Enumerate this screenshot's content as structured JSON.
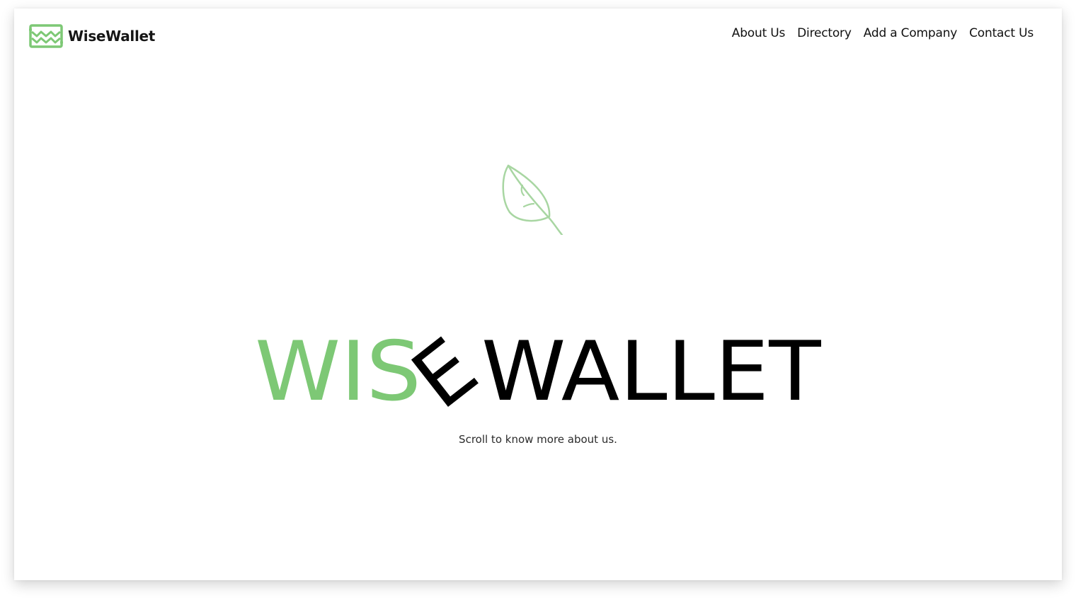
{
  "brand": {
    "name": "WiseWallet",
    "logo_icon": "wallet-wave-icon",
    "accent_color": "#7dc875"
  },
  "nav": {
    "items": [
      {
        "label": "About Us"
      },
      {
        "label": "Directory"
      },
      {
        "label": "Add a Company"
      },
      {
        "label": "Contact Us"
      }
    ]
  },
  "hero": {
    "icon": "leaf-icon",
    "icon_color": "#a8d6a2",
    "word_first": "WIS",
    "word_tilted_letter": "E",
    "word_second": "WALLET",
    "first_color": "#7dc875",
    "second_color": "#000000",
    "tagline": "Scroll to know more about us."
  }
}
